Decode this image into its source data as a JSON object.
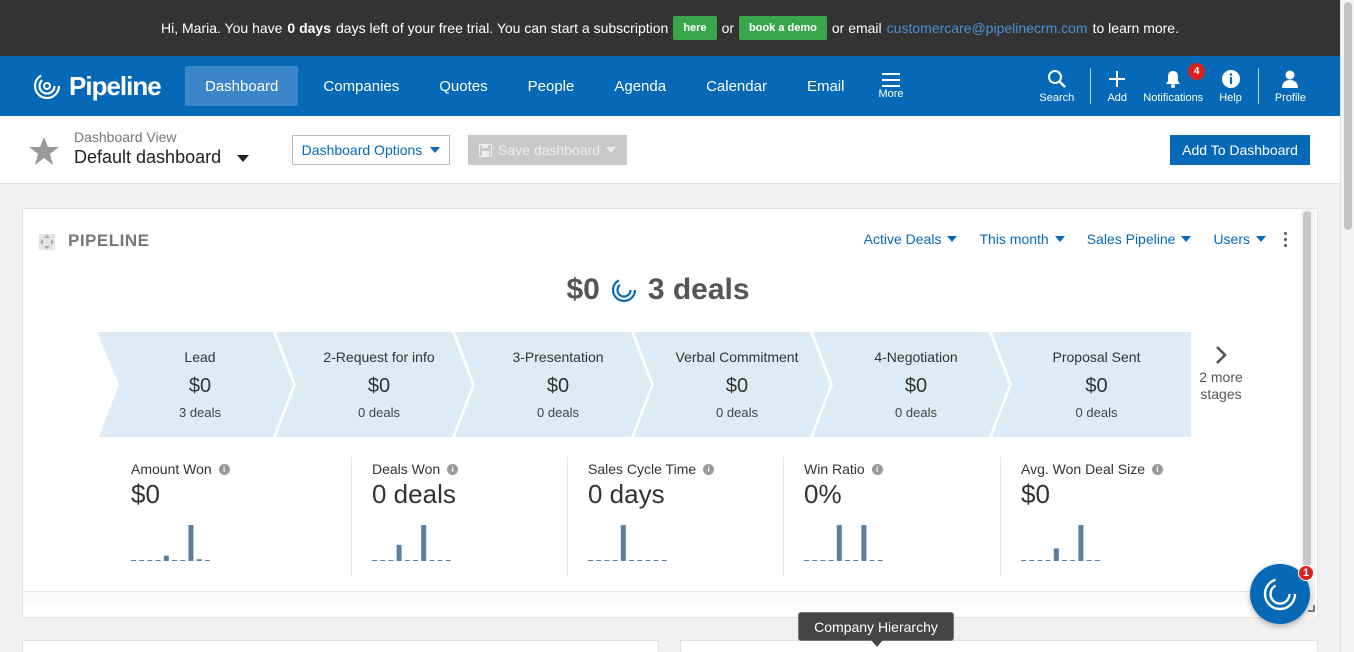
{
  "trial": {
    "greeting": "Hi, Maria. You have",
    "days_bold": "0 days",
    "middle": "days left of your free trial. You can start a subscription",
    "here_label": "here",
    "or1": "or",
    "demo_label": "book a demo",
    "or_email": "or email",
    "email": "customercare@pipelinecrm.com",
    "end": "to learn more."
  },
  "nav": {
    "brand": "Pipeline",
    "items": [
      "Dashboard",
      "Companies",
      "Quotes",
      "People",
      "Agenda",
      "Calendar",
      "Email"
    ],
    "more_label": "More",
    "right": {
      "search": "Search",
      "add": "Add",
      "notifications": "Notifications",
      "notifications_count": "4",
      "help": "Help",
      "profile": "Profile"
    }
  },
  "toolbar": {
    "view_label": "Dashboard View",
    "view_value": "Default dashboard",
    "options_label": "Dashboard Options",
    "save_label": "Save dashboard",
    "add_label": "Add To Dashboard"
  },
  "widget": {
    "title": "PIPELINE",
    "filters": [
      "Active Deals",
      "This month",
      "Sales Pipeline",
      "Users"
    ],
    "summary_amount": "$0",
    "summary_deals": "3 deals",
    "stages": [
      {
        "name": "Lead",
        "amount": "$0",
        "deals": "3 deals"
      },
      {
        "name": "2-Request for info",
        "amount": "$0",
        "deals": "0 deals"
      },
      {
        "name": "3-Presentation",
        "amount": "$0",
        "deals": "0 deals"
      },
      {
        "name": "Verbal Commitment",
        "amount": "$0",
        "deals": "0 deals"
      },
      {
        "name": "4-Negotiation",
        "amount": "$0",
        "deals": "0 deals"
      },
      {
        "name": "Proposal Sent",
        "amount": "$0",
        "deals": "0 deals"
      }
    ],
    "more_stages_line1": "2 more",
    "more_stages_line2": "stages",
    "metrics": [
      {
        "label": "Amount Won",
        "value": "$0",
        "bars": [
          0,
          0,
          0,
          0,
          0.15,
          0,
          0,
          1,
          0.05,
          0
        ]
      },
      {
        "label": "Deals Won",
        "value": "0 deals",
        "bars": [
          0,
          0,
          0,
          0.45,
          0,
          0,
          1,
          0,
          0,
          0
        ]
      },
      {
        "label": "Sales Cycle Time",
        "value": "0 days",
        "bars": [
          0,
          0,
          0,
          0,
          1,
          0,
          0,
          0,
          0,
          0
        ]
      },
      {
        "label": "Win Ratio",
        "value": "0%",
        "bars": [
          0,
          0,
          0,
          0,
          1,
          0,
          0,
          1,
          0,
          0
        ]
      },
      {
        "label": "Avg. Won Deal Size",
        "value": "$0",
        "bars": [
          0,
          0,
          0,
          0,
          0.35,
          0,
          0,
          1,
          0,
          0
        ]
      }
    ]
  },
  "tooltip": "Company Hierarchy",
  "chat_count": "1",
  "colors": {
    "nav": "#0569b7",
    "stage_fill": "#dcebf5",
    "green": "#3aa64c",
    "bar": "#5a7fa0"
  }
}
